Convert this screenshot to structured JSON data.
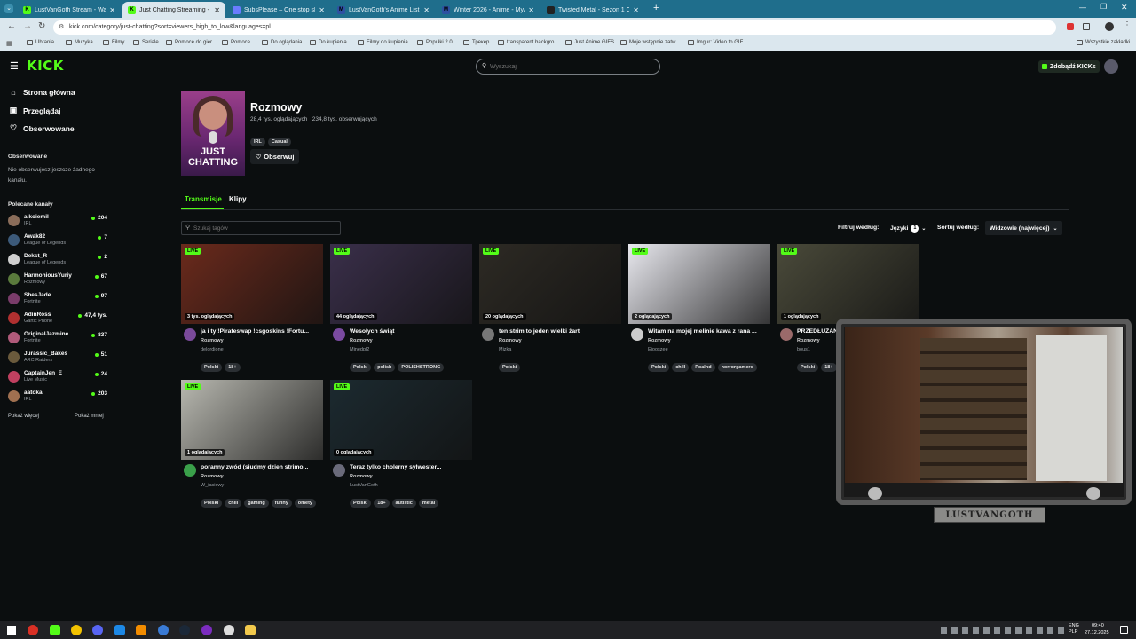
{
  "browser": {
    "tabs": [
      {
        "title": "LustVanGoth Stream - Watch L",
        "color": "#53fc18",
        "glyph": "K"
      },
      {
        "title": "Just Chatting Streaming - Live",
        "color": "#53fc18",
        "glyph": "K"
      },
      {
        "title": "SubsPlease – One stop shop fo",
        "color": "#6a7cff",
        "glyph": ""
      },
      {
        "title": "LustVanGoth's Anime List - My",
        "color": "#2e51a2",
        "glyph": "M"
      },
      {
        "title": "Winter 2026 - Anime - MyAnim",
        "color": "#2e51a2",
        "glyph": "M"
      },
      {
        "title": "Twisted Metal - Sezon 1 Odcin",
        "color": "#222222",
        "glyph": ""
      }
    ],
    "url": "kick.com/category/just-chatting?sort=viewers_high_to_low&languages=pl",
    "bookmarks": [
      "Ubrania",
      "Muzyka",
      "Filmy",
      "Seriale",
      "Pomoce do gier",
      "Pomoce",
      "Do oglądania",
      "Do kupienia",
      "Filmy do kupienia",
      "Popułki 2.0",
      "Трекер",
      "transparent backgro...",
      "Just Anime GIFS",
      "Moje wstępnie zatw...",
      "Imgur: Video to GIF"
    ],
    "all_bookmarks": "Wszystkie zakładki"
  },
  "header": {
    "logo": "KICK",
    "search_placeholder": "Wyszukaj",
    "kicks_button": "Zdobądź KICKs"
  },
  "sidebar": {
    "nav": [
      {
        "label": "Strona główna",
        "icon": "home-icon"
      },
      {
        "label": "Przeglądaj",
        "icon": "browse-icon"
      },
      {
        "label": "Obserwowane",
        "icon": "heart-icon"
      }
    ],
    "followed_heading": "Obserwowane",
    "followed_empty": "Nie obserwujesz jeszcze żadnego kanału.",
    "recommended_heading": "Polecane kanały",
    "channels": [
      {
        "name": "alkoiemil",
        "game": "IRL",
        "viewers": "204",
        "color": "#8a6d5a"
      },
      {
        "name": "Awak82",
        "game": "League of Legends",
        "viewers": "7",
        "color": "#3c5a7a"
      },
      {
        "name": "Dekst_R",
        "game": "League of Legends",
        "viewers": "2",
        "color": "#cfcfcf"
      },
      {
        "name": "HarmoniousYuriy",
        "game": "Rozmowy",
        "viewers": "67",
        "color": "#5a7a3c"
      },
      {
        "name": "ShesJade",
        "game": "Fortnite",
        "viewers": "97",
        "color": "#7a3c6a"
      },
      {
        "name": "AdinRoss",
        "game": "Gartic Phone",
        "viewers": "47,4 tys.",
        "color": "#b03030"
      },
      {
        "name": "OriginalJazmine",
        "game": "Fortnite",
        "viewers": "837",
        "color": "#b05a7a"
      },
      {
        "name": "Jurassic_Bakes",
        "game": "ARC Raiders",
        "viewers": "51",
        "color": "#6a5a3c"
      },
      {
        "name": "CaptainJen_E",
        "game": "Live Music",
        "viewers": "24",
        "color": "#c04060"
      },
      {
        "name": "aatoka",
        "game": "IRL",
        "viewers": "203",
        "color": "#a07050"
      }
    ],
    "show_more": "Pokaż więcej",
    "show_less": "Pokaż mniej"
  },
  "category": {
    "name": "Rozmowy",
    "stats": "28,4 tys. oglądających   234,8 tys. obserwujących",
    "tags": [
      "IRL",
      "Casual"
    ],
    "follow_button": "Obserwuj",
    "cover_text_1": "JUST",
    "cover_text_2": "CHATTING"
  },
  "tabs": [
    "Transmisje",
    "Klipy"
  ],
  "filters": {
    "tag_search_placeholder": "Szukaj tagów",
    "filter_label": "Filtruj według:",
    "languages": "Języki",
    "languages_count": "1",
    "sort_label": "Sortuj według:",
    "sort_value": "Widzowie (najwięcej)"
  },
  "live_label": "LIVE",
  "streams": [
    {
      "viewers": "3 tys. oglądających",
      "title": "ja i ty !Pirateswap !csgoskins !Fortu...",
      "category": "Rozmowy",
      "user": "delordione",
      "tags": [
        "Polski",
        "18+"
      ],
      "thumb": "#6b2a1c",
      "av": "#7a4a9a"
    },
    {
      "viewers": "44 oglądających",
      "title": "Wesołych świąt",
      "category": "Rozmowy",
      "user": "Minedpl2",
      "tags": [
        "Polski",
        "polish",
        "POLISHSTRONG"
      ],
      "thumb": "#3a2f4a",
      "av": "#7a4aa0"
    },
    {
      "viewers": "20 oglądających",
      "title": "ten strim to jeden wielki żart",
      "category": "Rozmowy",
      "user": "Mizka",
      "tags": [
        "Polski"
      ],
      "thumb": "#2d2a24",
      "av": "#777777"
    },
    {
      "viewers": "2 oglądających",
      "title": "Witam na mojej melinie kawa z rana ...",
      "category": "Rozmowy",
      "user": "Ejooszee",
      "tags": [
        "Polski",
        "chill",
        "Poalnd",
        "horrorgamers"
      ],
      "thumb": "#e8e8ee",
      "av": "#cccccc"
    },
    {
      "viewers": "1 oglądających",
      "title": "PRZEDŁUŻANY",
      "category": "Rozmowy",
      "user": "bous1",
      "tags": [
        "Polski",
        "18+"
      ],
      "thumb": "#4a4a3a",
      "av": "#9a6a6a"
    },
    {
      "viewers": "1 oglądających",
      "title": "poranny zwód (siudmy dzien strimo...",
      "category": "Rozmowy",
      "user": "W_iasiowy",
      "tags": [
        "Polski",
        "chill",
        "gaming",
        "funny",
        "omety"
      ],
      "thumb": "#b8b8b0",
      "av": "#3aa04a"
    },
    {
      "viewers": "0 oglądających",
      "title": "Teraz tylko cholerny sylwester...",
      "category": "Rozmowy",
      "user": "LustVanGoth",
      "tags": [
        "Polski",
        "18+",
        "autistic",
        "metal"
      ],
      "thumb": "#1c2a30",
      "av": "#6a6a7a"
    }
  ],
  "overlay": {
    "nameplate": "LUSTVANGOTH"
  },
  "taskbar": {
    "lang": "ENG\nPLP",
    "time": "09:40",
    "date": "27.12.2025"
  }
}
